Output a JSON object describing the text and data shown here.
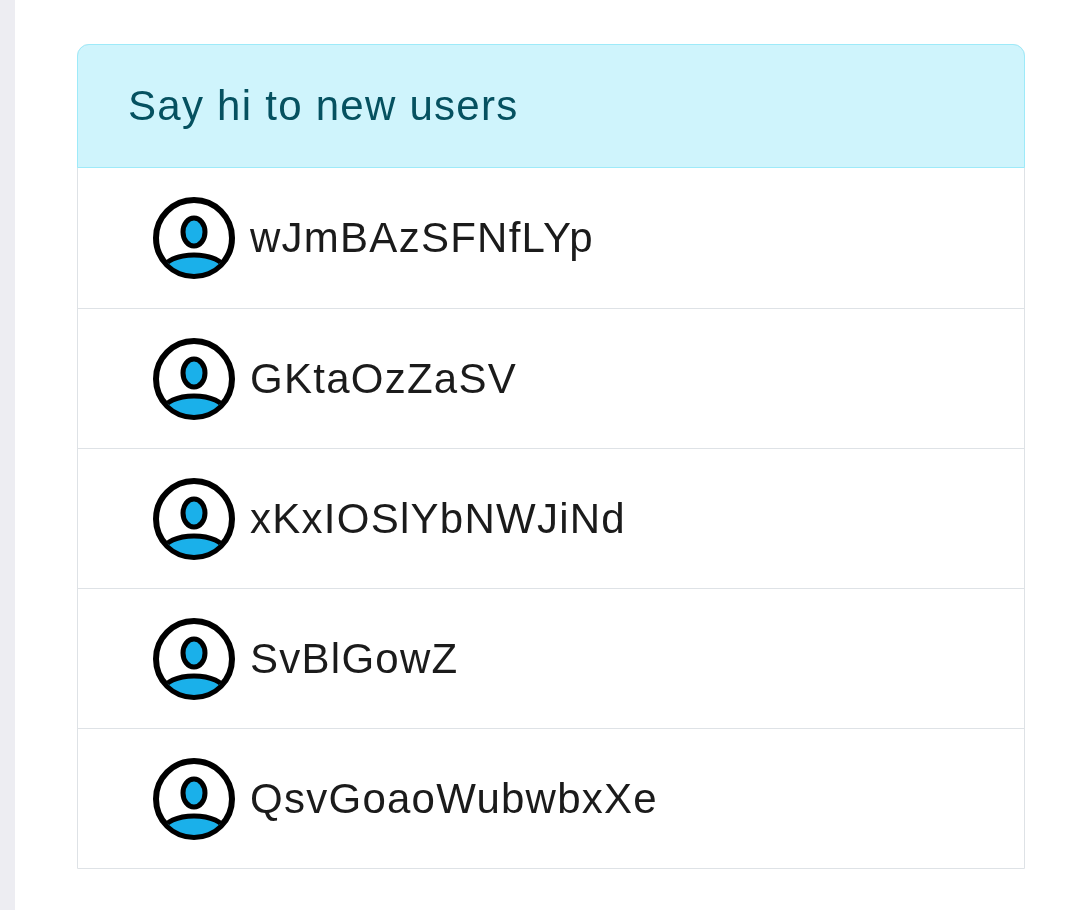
{
  "card": {
    "title": "Say hi to new users"
  },
  "users": [
    {
      "name": "wJmBAzSFNfLYp"
    },
    {
      "name": "GKtaOzZaSV"
    },
    {
      "name": "xKxIOSlYbNWJiNd"
    },
    {
      "name": "SvBlGowZ"
    },
    {
      "name": "QsvGoaoWubwbxXe"
    }
  ]
}
